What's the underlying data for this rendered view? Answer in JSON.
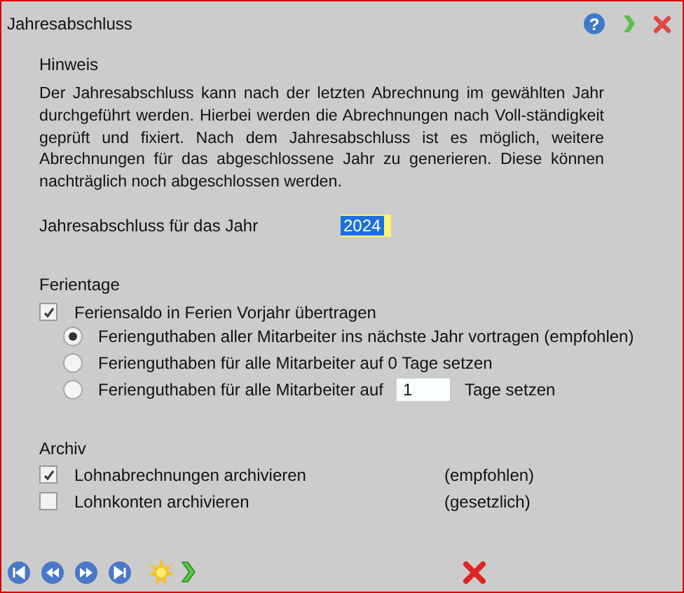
{
  "window": {
    "title": "Jahresabschluss",
    "help": "?"
  },
  "notice": {
    "heading": "Hinweis",
    "text": "Der Jahresabschluss kann nach der letzten Abrechnung im gewählten Jahr durchgeführt werden. Hierbei werden die Abrechnungen nach Voll-ständigkeit geprüft und fixiert. Nach dem Jahresabschluss ist es möglich, weitere Abrechnungen für das abgeschlossene Jahr zu generieren. Diese können nachträglich noch abgeschlossen werden."
  },
  "year": {
    "label": "Jahresabschluss für das Jahr",
    "value": "2024",
    "selected": true
  },
  "vacation": {
    "heading": "Ferientage",
    "carry_over": {
      "label": "Feriensaldo in Ferien Vorjahr übertragen",
      "checked": true
    },
    "options": [
      {
        "label": "Ferienguthaben aller Mitarbeiter ins nächste Jahr vortragen (empfohlen)",
        "selected": true
      },
      {
        "label": "Ferienguthaben für alle Mitarbeiter auf 0 Tage setzen",
        "selected": false
      },
      {
        "label": "Ferienguthaben für alle Mitarbeiter auf",
        "value": "1",
        "suffix": "Tage setzen",
        "selected": false
      }
    ]
  },
  "archive": {
    "heading": "Archiv",
    "items": [
      {
        "label": "Lohnabrechnungen archivieren",
        "note": "(empfohlen)",
        "checked": true
      },
      {
        "label": "Lohnkonten archivieren",
        "note": "(gesetzlich)",
        "checked": false
      }
    ]
  }
}
